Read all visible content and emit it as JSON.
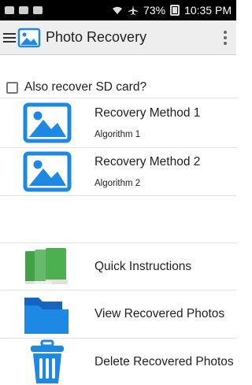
{
  "status_bar": {
    "battery": "73%",
    "time": "10:35 PM"
  },
  "app_bar": {
    "title": "Photo Recovery"
  },
  "sd_option": {
    "label": "Also recover SD card?",
    "checked": false
  },
  "methods": [
    {
      "title": "Recovery Method 1",
      "subtitle": "Algorithm 1"
    },
    {
      "title": "Recovery Method 2",
      "subtitle": "Algorithm 2"
    }
  ],
  "actions": {
    "quick_instructions": "Quick Instructions",
    "view_recovered": "View Recovered Photos",
    "delete_recovered": "Delete Recovered Photos"
  },
  "colors": {
    "photo_icon_blue": "#1e88e5",
    "book_green": "#4caf50",
    "folder_blue": "#1e88e5",
    "trash_blue": "#1e88e5"
  }
}
